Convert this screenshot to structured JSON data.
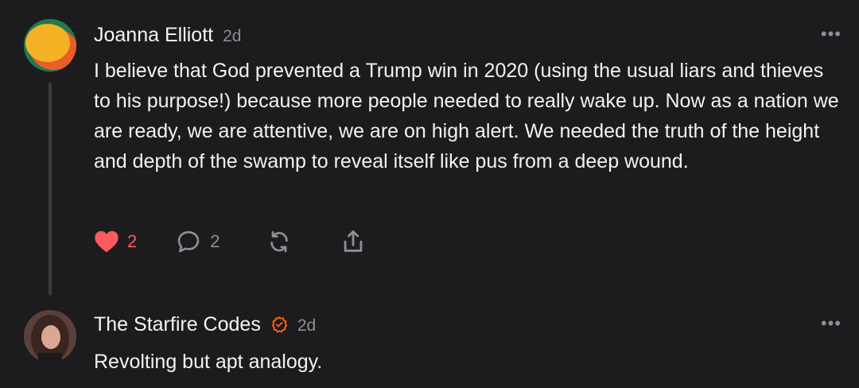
{
  "comments": [
    {
      "author": "Joanna Elliott",
      "time": "2d",
      "more": "•••",
      "text": "I believe that God prevented a Trump win in 2020 (using the usual liars and thieves to his purpose!) because more people needed to really wake up. Now as a nation we are ready, we are attentive, we are on high alert. We needed the truth of the height and depth of the swamp to reveal itself like pus from a deep wound.",
      "likes": "2",
      "replies": "2",
      "icons": [
        "heart-icon",
        "comment-icon",
        "restack-icon",
        "share-icon"
      ]
    },
    {
      "author": "The Starfire Codes",
      "time": "2d",
      "more": "•••",
      "verified": true,
      "text": "Revolting but apt analogy."
    }
  ],
  "colors": {
    "background": "#1c1c1e",
    "like_active": "#ff5a5f",
    "muted": "#8e8e93",
    "verified_badge": "#ff6719"
  }
}
